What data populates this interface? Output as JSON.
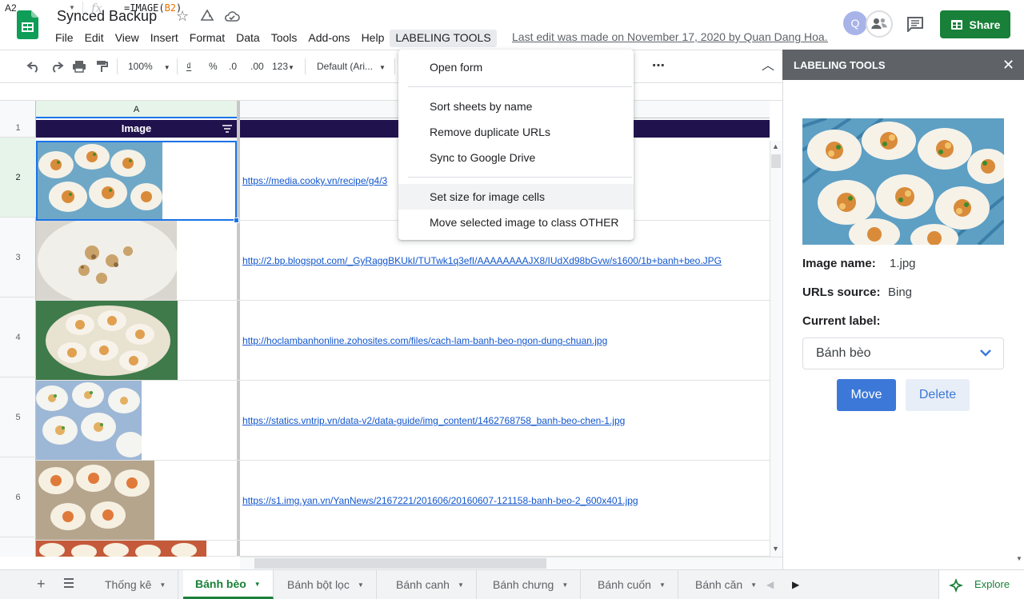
{
  "header": {
    "title": "Synced Backup",
    "menu": [
      "File",
      "Edit",
      "View",
      "Insert",
      "Format",
      "Data",
      "Tools",
      "Add-ons",
      "Help"
    ],
    "labeling_menu": "LABELING TOOLS",
    "last_edit": "Last edit was made on November 17, 2020 by Quan Dang Hoa...",
    "avatar_initial": "Q",
    "share_label": "Share"
  },
  "toolbar": {
    "zoom": "100%",
    "currency": "₫",
    "percent": "%",
    "dec_less": ".0",
    "dec_more": ".00",
    "more_formats": "123",
    "font": "Default (Ari...",
    "more": "⋯"
  },
  "formula_bar": {
    "name_box": "A2",
    "fx": "fx",
    "formula_prefix": "=IMAGE(",
    "formula_ref": "B2",
    "formula_suffix": ")"
  },
  "grid": {
    "column_a": "A",
    "header_image": "Image",
    "rows": [
      {
        "num": "1"
      },
      {
        "num": "2",
        "url": "https://media.cooky.vn/recipe/g4/3"
      },
      {
        "num": "3",
        "url": "http://2.bp.blogspot.com/_GyRaggBKUkI/TUTwk1q3efI/AAAAAAAAJX8/IUdXd98bGvw/s1600/1b+banh+beo.JPG"
      },
      {
        "num": "4",
        "url": "http://hoclambanhonline.zohosites.com/files/cach-lam-banh-beo-ngon-dung-chuan.jpg"
      },
      {
        "num": "5",
        "url": "https://statics.vntrip.vn/data-v2/data-guide/img_content/1462768758_banh-beo-chen-1.jpg"
      },
      {
        "num": "6",
        "url": "https://s1.img.yan.vn/YanNews/2167221/201606/20160607-121158-banh-beo-2_600x401.jpg"
      }
    ]
  },
  "dropdown": {
    "items": [
      "Open form",
      "Sort sheets by name",
      "Remove duplicate URLs",
      "Sync to Google Drive",
      "Set size for image cells",
      "Move selected image to class OTHER"
    ]
  },
  "sidebar": {
    "title": "LABELING TOOLS",
    "image_name_label": "Image name:",
    "image_name_value": "1.jpg",
    "source_label": "URLs source:",
    "source_value": "Bing",
    "current_label_label": "Current label:",
    "current_label_value": "Bánh bèo",
    "move_label": "Move",
    "delete_label": "Delete"
  },
  "sheets": {
    "tabs": [
      "Thống kê",
      "Bánh bèo",
      "Bánh bột lọc",
      "Bánh canh",
      "Bánh chưng",
      "Bánh cuốn",
      "Bánh căn"
    ],
    "active_index": 1,
    "explore_label": "Explore"
  },
  "colors": {
    "brand_green": "#188038",
    "header_purple": "#20124d",
    "link_blue": "#1155cc",
    "selection_blue": "#1a73e8",
    "sidebar_head": "#5f6368"
  }
}
